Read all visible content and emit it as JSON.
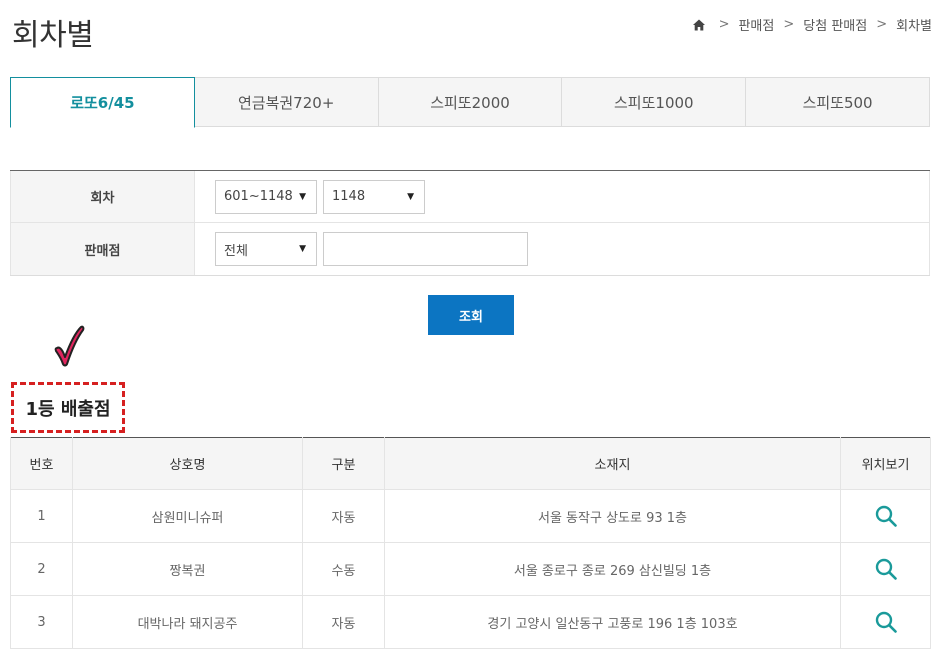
{
  "page": {
    "title": "회차별"
  },
  "breadcrumb": {
    "items": [
      "판매점",
      "당첨 판매점",
      "회차별"
    ]
  },
  "tabs": [
    {
      "label": "로또6/45",
      "active": true
    },
    {
      "label": "연금복권720+",
      "active": false
    },
    {
      "label": "스피또2000",
      "active": false
    },
    {
      "label": "스피또1000",
      "active": false
    },
    {
      "label": "스피또500",
      "active": false
    }
  ],
  "search": {
    "round_label": "회차",
    "round_range": "601~1148",
    "round_value": "1148",
    "store_label": "판매점",
    "region_value": "전체",
    "store_input_value": "",
    "submit_label": "조회"
  },
  "results": {
    "heading": "1등 배출점",
    "columns": [
      "번호",
      "상호명",
      "구분",
      "소재지",
      "위치보기"
    ],
    "rows": [
      {
        "no": "1",
        "name": "삼원미니슈퍼",
        "type": "자동",
        "address": "서울 동작구 상도로 93 1층"
      },
      {
        "no": "2",
        "name": "짱복권",
        "type": "수동",
        "address": "서울 종로구 종로 269 삼신빌딩 1층"
      },
      {
        "no": "3",
        "name": "대박나라 돼지공주",
        "type": "자동",
        "address": "경기 고양시 일산동구 고풍로 196 1층 103호"
      }
    ]
  },
  "colors": {
    "accent": "#138f9e",
    "button": "#0c75c2",
    "highlight": "#d62020",
    "check": "#e0245e"
  },
  "icons": {
    "home": "home-icon",
    "location": "magnifier-icon",
    "annotation": "check-mark-icon"
  }
}
